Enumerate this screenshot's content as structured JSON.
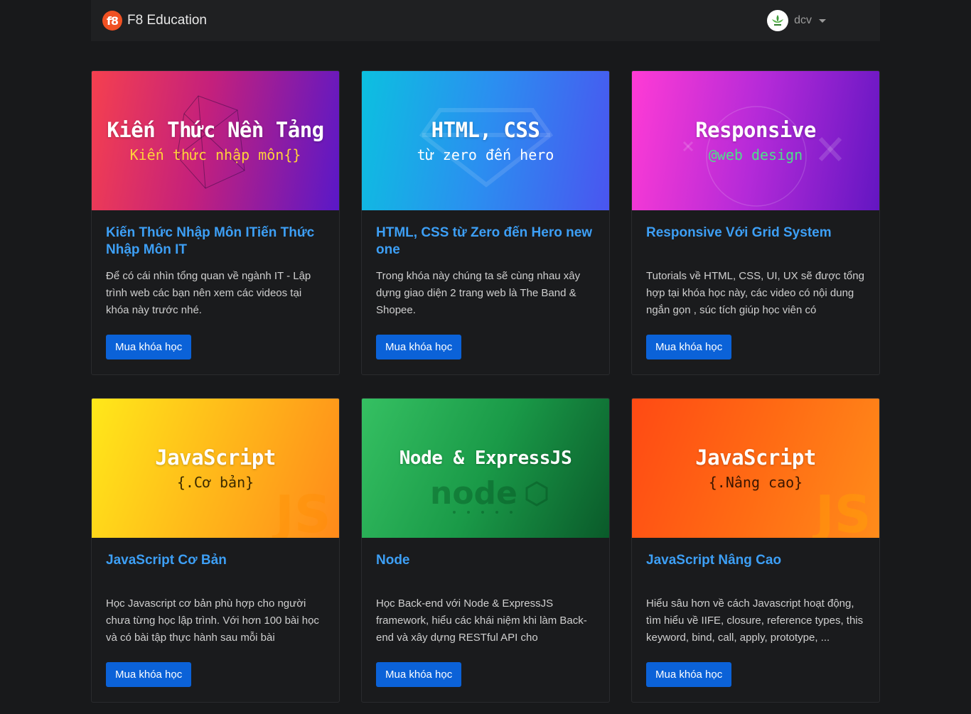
{
  "navbar": {
    "brand_logo_text": "f8",
    "brand_name": "F8 Education",
    "username": "dcv",
    "avatar_icon": "leaf-logo-icon"
  },
  "colors": {
    "background": "#18191b",
    "card": "#1a1b1d",
    "title_link": "#3d9ff5",
    "button": "#0b62d8"
  },
  "courses": [
    {
      "thumb_title": "Kiến Thức Nền Tảng",
      "thumb_sub": "Kiến thức nhập môn{}",
      "thumb_sub_color": "#ffd23a",
      "title": "Kiến Thức Nhập Môn ITiến Thức Nhập Môn IT",
      "desc": "Để có cái nhìn tổng quan về ngành IT - Lập trình web các bạn nên xem các videos tại khóa này trước nhé.",
      "button": "Mua khóa học"
    },
    {
      "thumb_title": "HTML, CSS",
      "thumb_sub": "từ zero đến hero",
      "thumb_sub_color": "#ffffff",
      "title": "HTML, CSS từ Zero đến Hero new one",
      "desc": "Trong khóa này chúng ta sẽ cùng nhau xây dựng giao diện 2 trang web là The Band & Shopee.",
      "button": "Mua khóa học"
    },
    {
      "thumb_title": "Responsive",
      "thumb_sub": "@web design",
      "thumb_sub_color": "#4ee08a",
      "title": "Responsive Với Grid System",
      "desc": "Tutorials về HTML, CSS, UI, UX sẽ được tổng hợp tại khóa học này, các video có nội dung ngắn gọn , súc tích giúp học viên có",
      "button": "Mua khóa học"
    },
    {
      "thumb_title": "JavaScript",
      "thumb_sub": "{.Cơ bản}",
      "thumb_sub_color": "#3a2a00",
      "title": "JavaScript Cơ Bản",
      "desc": "Học Javascript cơ bản phù hợp cho người chưa từng học lập trình. Với hơn 100 bài học và có bài tập thực hành sau mỗi bài",
      "button": "Mua khóa học"
    },
    {
      "thumb_title": "Node & ExpressJS",
      "thumb_sub": "",
      "thumb_sub_color": "#ffffff",
      "title": "Node",
      "desc": "Học Back-end với Node & ExpressJS framework, hiểu các khái niệm khi làm Back-end và xây dựng RESTful API cho",
      "button": "Mua khóa học"
    },
    {
      "thumb_title": "JavaScript",
      "thumb_sub": "{.Nâng cao}",
      "thumb_sub_color": "#3a1500",
      "title": "JavaScript Nâng Cao",
      "desc": "Hiểu sâu hơn về cách Javascript hoạt động, tìm hiểu về IIFE, closure, reference types, this keyword, bind, call, apply, prototype, ...",
      "button": "Mua khóa học"
    }
  ]
}
